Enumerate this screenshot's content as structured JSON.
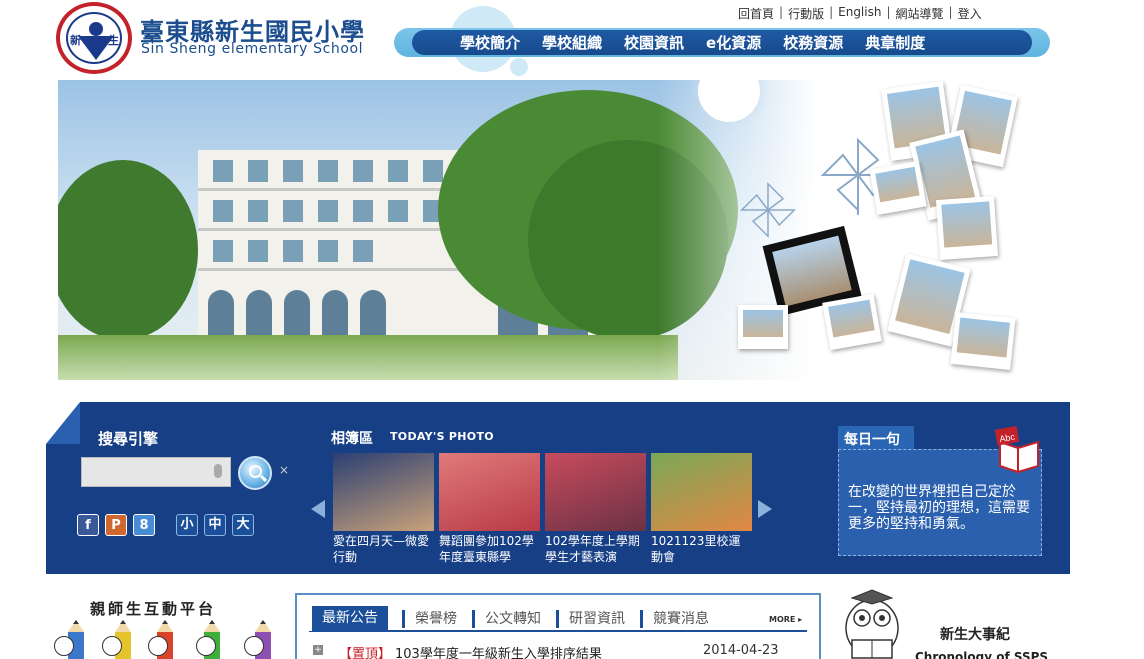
{
  "header": {
    "school_name_zh": "臺東縣新生國民小學",
    "school_name_en": "Sin Sheng elementary School",
    "logo_chars": [
      "新",
      "生"
    ],
    "top_links": [
      "回首頁",
      "行動版",
      "English",
      "網站導覽",
      "登入"
    ],
    "nav": [
      "學校簡介",
      "學校組織",
      "校園資訊",
      "e化資源",
      "校務資源",
      "典章制度"
    ]
  },
  "search": {
    "title": "搜尋引擎",
    "placeholder": "",
    "close": "×"
  },
  "social": [
    {
      "icon": "facebook-icon",
      "label": "f",
      "color": "#3b5998"
    },
    {
      "icon": "plurk-icon",
      "label": "P",
      "color": "#cf682f"
    },
    {
      "icon": "google-plus-icon",
      "label": "8",
      "color": "#4a8bd6"
    }
  ],
  "font_size": [
    "小",
    "中",
    "大"
  ],
  "album": {
    "title": "相簿區",
    "subtitle": "TODAY'S PHOTO",
    "photos": [
      {
        "caption": "愛在四月天—微愛行動",
        "colors": [
          "#2b3f73",
          "#c9a27a"
        ]
      },
      {
        "caption": "舞蹈團參加102學年度臺東縣學",
        "colors": [
          "#e07a7a",
          "#b83a47"
        ]
      },
      {
        "caption": "102學年度上學期學生才藝表演",
        "colors": [
          "#c84b5d",
          "#6b3245"
        ]
      },
      {
        "caption": "1021123里校運動會",
        "colors": [
          "#7aa857",
          "#e28744"
        ]
      }
    ]
  },
  "daily_quote": {
    "title": "每日一句",
    "text": "在改變的世界裡把自己定於一，堅持最初的理想，這需要更多的堅持和勇氣。",
    "book_label": "Abc"
  },
  "interaction": {
    "title": "親師生互動平台"
  },
  "news": {
    "tabs": [
      "最新公告",
      "榮譽榜",
      "公文轉知",
      "研習資訊",
      "競賽消息"
    ],
    "more": "MORE ▸",
    "items": [
      {
        "tag": "【置頂】",
        "text": "103學年度一年級新生入學排序結果",
        "date": "2014-04-23"
      }
    ]
  },
  "chronicle": {
    "title_zh": "新生大事紀",
    "title_en": "Chronology of SSPS"
  }
}
